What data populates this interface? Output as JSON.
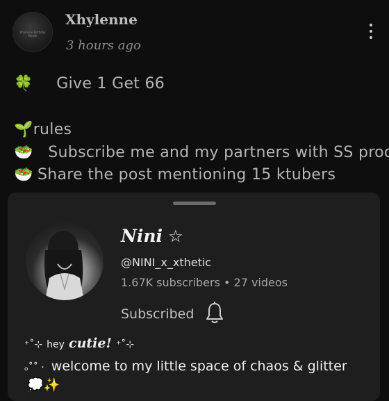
{
  "post": {
    "author": "Xhylenne",
    "timestamp": "3 hours ago",
    "avatar_text": "Xhylenne Birthday Month",
    "lines": [
      {
        "icon": "🍀",
        "icon_name": "four-leaf-clover",
        "text": "Give 1 Get 66"
      },
      {
        "icon": "🌱",
        "icon_name": "seedling",
        "text": "rules"
      },
      {
        "icon": "🥗",
        "icon_name": "salad-bowl",
        "text": "Subscribe me and my partners with SS proof"
      },
      {
        "icon": "🥗",
        "icon_name": "salad-bowl",
        "text": "Share the post mentioning 15 ktubers"
      }
    ]
  },
  "channel": {
    "name": "Nini",
    "star": "☆",
    "handle": "@NINI_x_xthetic",
    "stats": "1.67K subscribers • 27 videos",
    "subscribed_label": "Subscribed",
    "bio": {
      "line1_pre": "⁺˚⊹",
      "line1_hey": "hey",
      "line1_cutie": "cutie!",
      "line1_post": "⁺˚⊹",
      "line2_pre": "ₒ˚˚ ·",
      "line2_text": "welcome to my little space of chaos & glitter",
      "line3": "💭✨"
    }
  },
  "colors": {
    "background": "#0e0e0e",
    "card": "#1e1e1e",
    "text_primary": "#f0f0f0",
    "text_muted": "#a6a6a6"
  }
}
